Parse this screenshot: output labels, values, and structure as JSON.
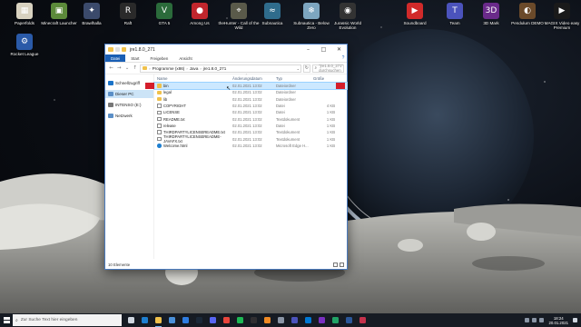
{
  "desktop": {
    "icons": [
      {
        "label": "Paperfolds",
        "color": "#d8d2c0",
        "glyph": "▦"
      },
      {
        "label": "Minecraft Launcher",
        "color": "#5c8a3a",
        "glyph": "▣"
      },
      {
        "label": "Brawlhalla",
        "color": "#3b4a6b",
        "glyph": "✦"
      },
      {
        "label": "Raft",
        "color": "#2a2a2a",
        "glyph": "R"
      },
      {
        "label": "GTA 5",
        "color": "#2b6b3b",
        "glyph": "V"
      },
      {
        "label": "Among Us",
        "color": "#c0262d",
        "glyph": "●"
      },
      {
        "label": "theHunter - Call of the Wild",
        "color": "#5a5a4a",
        "glyph": "⌖"
      },
      {
        "label": "Subnautica",
        "color": "#2f6c8c",
        "glyph": "≈"
      },
      {
        "label": "Subnautica - Below Zero",
        "color": "#7da6c0",
        "glyph": "❄"
      },
      {
        "label": "Jurassic World Evolution",
        "color": "#333333",
        "glyph": "◉"
      },
      {
        "label": "Soundboard",
        "color": "#d12a2a",
        "glyph": "▶"
      },
      {
        "label": "Team",
        "color": "#4b53bc",
        "glyph": "T"
      },
      {
        "label": "3D Mark",
        "color": "#6a2a8a",
        "glyph": "3D"
      },
      {
        "label": "Pendulum DEMO",
        "color": "#6b4a2a",
        "glyph": "◐"
      },
      {
        "label": "MAGIX Video easy Premium",
        "color": "#1a1a1a",
        "glyph": "▶"
      },
      {
        "label": "Rocket League",
        "color": "#2a5aa8",
        "glyph": "⚙"
      }
    ]
  },
  "explorer": {
    "title": "jre1.8.0_271",
    "ribbon_tabs": [
      "Datei",
      "Start",
      "Freigeben",
      "Ansicht"
    ],
    "address_crumbs": [
      "Programme (x86)",
      "Java",
      "jre1.8.0_271"
    ],
    "search_placeholder": "\"jre1.8.0_271\" durchsuchen",
    "nav": [
      {
        "label": "Schnellzugriff",
        "color": "#1a73c8"
      },
      {
        "label": "Dieser PC",
        "color": "#5b8fc7"
      },
      {
        "label": "INTENSO (E:)",
        "color": "#777777"
      },
      {
        "label": "Netzwerk",
        "color": "#5b8fc7"
      }
    ],
    "columns": {
      "name": "Name",
      "date": "Änderungsdatum",
      "type": "Typ",
      "size": "Größe"
    },
    "files": [
      {
        "name": "bin",
        "date": "02.01.2021 13:02",
        "type": "Dateiordner",
        "size": "",
        "icon": "folder"
      },
      {
        "name": "legal",
        "date": "02.01.2021 13:02",
        "type": "Dateiordner",
        "size": "",
        "icon": "folder"
      },
      {
        "name": "lib",
        "date": "02.01.2021 13:02",
        "type": "Dateiordner",
        "size": "",
        "icon": "folder"
      },
      {
        "name": "COPYRIGHT",
        "date": "02.01.2021 13:02",
        "type": "Datei",
        "size": "4 KB",
        "icon": "file"
      },
      {
        "name": "LICENSE",
        "date": "02.01.2021 13:02",
        "type": "Datei",
        "size": "1 KB",
        "icon": "file"
      },
      {
        "name": "README.txt",
        "date": "02.01.2021 13:02",
        "type": "Textdokument",
        "size": "1 KB",
        "icon": "file"
      },
      {
        "name": "release",
        "date": "02.01.2021 13:02",
        "type": "Datei",
        "size": "1 KB",
        "icon": "file"
      },
      {
        "name": "THIRDPARTYLICENSEREADME.txt",
        "date": "02.01.2021 13:02",
        "type": "Textdokument",
        "size": "1 KB",
        "icon": "file"
      },
      {
        "name": "THIRDPARTYLICENSEREADME-JAVAFX.txt",
        "date": "02.01.2021 13:02",
        "type": "Textdokument",
        "size": "1 KB",
        "icon": "file"
      },
      {
        "name": "Welcome.html",
        "date": "02.01.2021 13:02",
        "type": "Microsoft Edge H...",
        "size": "1 KB",
        "icon": "edge"
      }
    ],
    "status": "10 Elemente"
  },
  "taskbar": {
    "search_placeholder": "Zur Suche Text hier eingeben",
    "apps": [
      {
        "name": "task-view",
        "color": "#cfd6df"
      },
      {
        "name": "edge",
        "color": "#1e7fd0"
      },
      {
        "name": "explorer",
        "color": "#f0c14b",
        "active": true
      },
      {
        "name": "store",
        "color": "#4a90d9"
      },
      {
        "name": "mail",
        "color": "#2f7de1"
      },
      {
        "name": "steam",
        "color": "#1b2838"
      },
      {
        "name": "discord",
        "color": "#5865f2"
      },
      {
        "name": "chrome",
        "color": "#e8453c"
      },
      {
        "name": "spotify",
        "color": "#1db954"
      },
      {
        "name": "obs",
        "color": "#302e31"
      },
      {
        "name": "vlc",
        "color": "#f08a24"
      },
      {
        "name": "settings",
        "color": "#8a95a5"
      },
      {
        "name": "teams",
        "color": "#4b53bc"
      },
      {
        "name": "photos",
        "color": "#0078d4"
      },
      {
        "name": "media",
        "color": "#7a2fc0"
      },
      {
        "name": "editor",
        "color": "#21a366"
      },
      {
        "name": "word",
        "color": "#2b579a"
      },
      {
        "name": "misc",
        "color": "#c4314b"
      }
    ],
    "time": "18:24",
    "date": "20.01.2021"
  }
}
